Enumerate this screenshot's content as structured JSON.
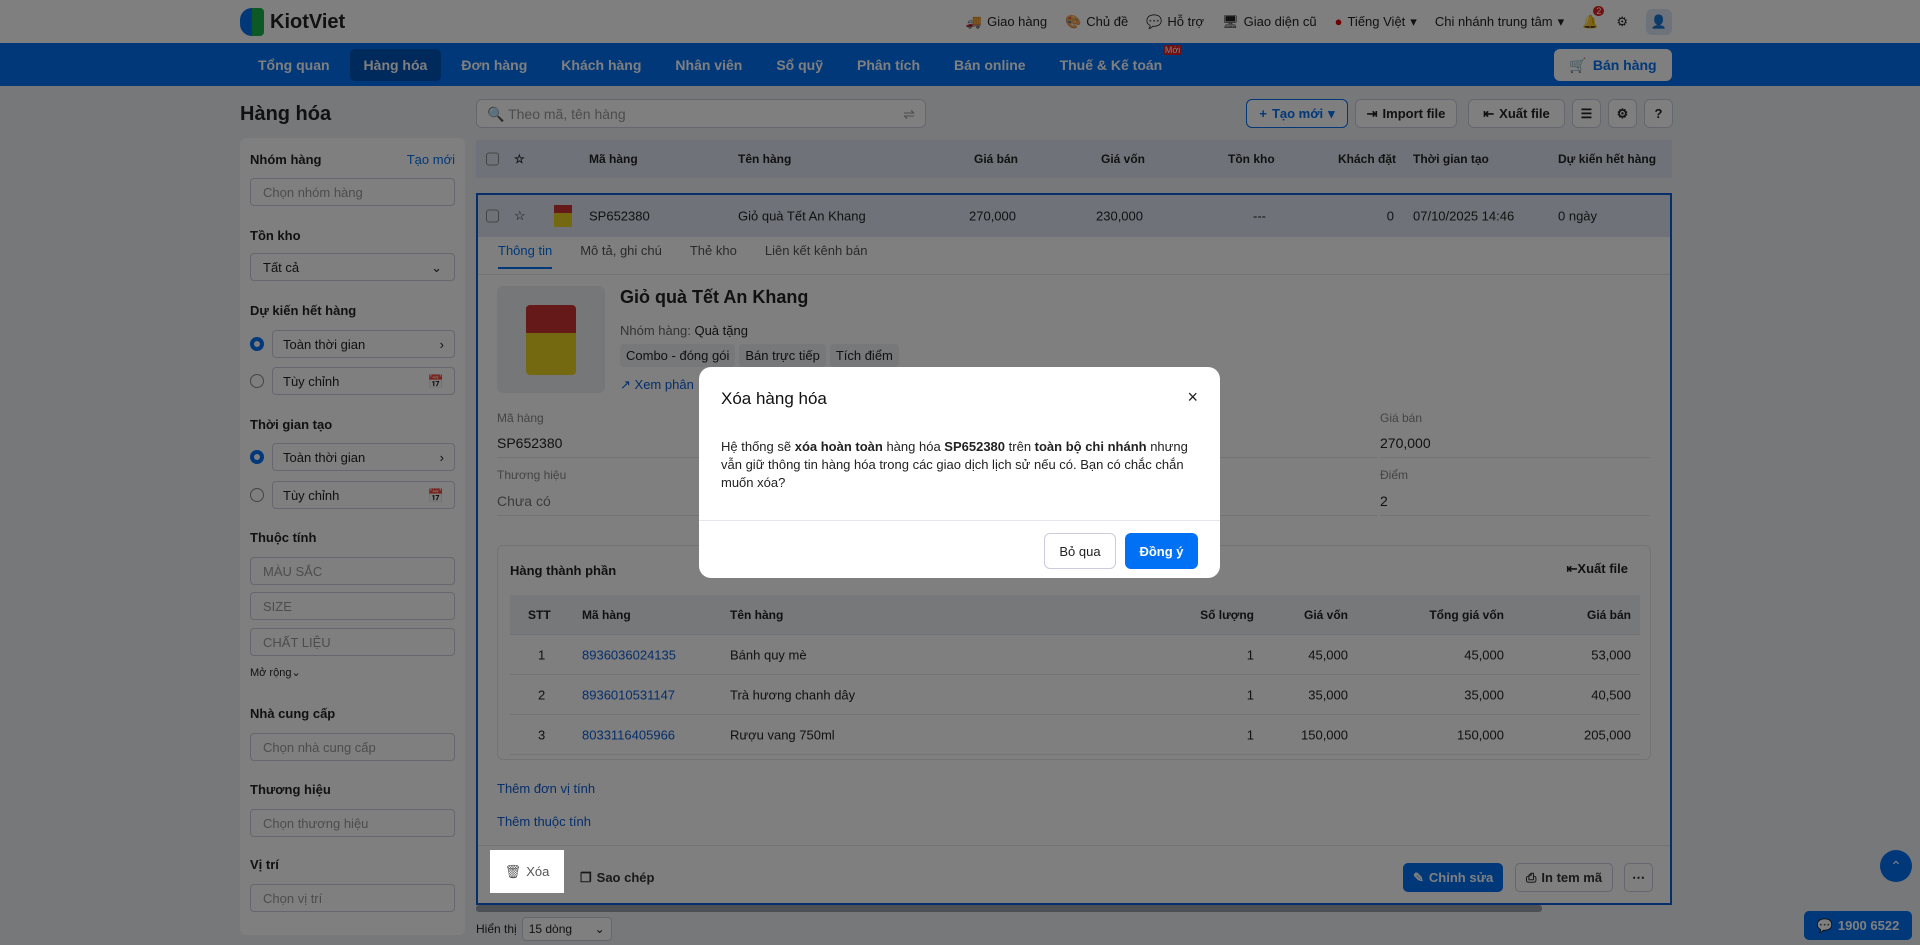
{
  "header": {
    "logo": "KiotViet",
    "links": [
      "Giao hàng",
      "Chủ đề",
      "Hỗ trợ",
      "Giao diện cũ"
    ],
    "language": "Tiếng Việt",
    "branch": "Chi nhánh trung tâm",
    "notifications": "2"
  },
  "nav": {
    "items": [
      "Tổng quan",
      "Hàng hóa",
      "Đơn hàng",
      "Khách hàng",
      "Nhân viên",
      "Sổ quỹ",
      "Phân tích",
      "Bán online",
      "Thuế & Kế toán"
    ],
    "new_badge": "Mới",
    "sell": "Bán hàng"
  },
  "page_title": "Hàng hóa",
  "sidebar": {
    "group_label": "Nhóm hàng",
    "group_create": "Tạo mới",
    "group_ph": "Chọn nhóm hàng",
    "stock_label": "Tồn kho",
    "stock_value": "Tất cả",
    "expected_label": "Dự kiến hết hàng",
    "all_time": "Toàn thời gian",
    "custom": "Tùy chỉnh",
    "created_label": "Thời gian tạo",
    "attr_label": "Thuộc tính",
    "attrs": [
      "MÀU SẮC",
      "SIZE",
      "CHẤT LIỆU"
    ],
    "expand": "Mở rộng",
    "supplier_label": "Nhà cung cấp",
    "supplier_ph": "Chọn nhà cung cấp",
    "brand_label": "Thương hiệu",
    "brand_ph": "Chọn thương hiệu",
    "location_label": "Vị trí",
    "location_ph": "Chọn vị trí"
  },
  "toolbar": {
    "search_ph": "Theo mã, tên hàng",
    "create": "Tạo mới",
    "import": "Import file",
    "export": "Xuất file"
  },
  "table": {
    "headers": [
      "Mã hàng",
      "Tên hàng",
      "Giá bán",
      "Giá vốn",
      "Tồn kho",
      "Khách đặt",
      "Thời gian tạo",
      "Dự kiến hết hàng"
    ],
    "row": [
      "SP652380",
      "Giỏ quà Tết An Khang",
      "270,000",
      "230,000",
      "---",
      "0",
      "07/10/2025 14:46",
      "0 ngày"
    ]
  },
  "detail": {
    "tabs": [
      "Thông tin",
      "Mô tả, ghi chú",
      "Thẻ kho",
      "Liên kết kênh bán"
    ],
    "name": "Giỏ quà Tết An Khang",
    "group_label": "Nhóm hàng:",
    "group_value": "Quà tặng",
    "chips": [
      "Combo - đóng gói",
      "Bán trực tiếp",
      "Tích điểm"
    ],
    "view_link": "Xem phân",
    "fields": {
      "code_label": "Mã hàng",
      "code": "SP652380",
      "brand_label": "Thương hiệu",
      "brand": "Chưa có",
      "price_label": "Giá bán",
      "price": "270,000",
      "points_label": "Điểm",
      "points": "2"
    },
    "components_title": "Hàng thành phần",
    "components_export": "Xuất file",
    "comp_headers": [
      "STT",
      "Mã hàng",
      "Tên hàng",
      "Số lượng",
      "Giá vốn",
      "Tổng giá vốn",
      "Giá bán"
    ],
    "comp_rows": [
      [
        "1",
        "8936036024135",
        "Bánh quy mè",
        "1",
        "45,000",
        "45,000",
        "53,000"
      ],
      [
        "2",
        "8936010531147",
        "Trà hương chanh dây",
        "1",
        "35,000",
        "35,000",
        "40,500"
      ],
      [
        "3",
        "8033116405966",
        "Rượu vang 750ml",
        "1",
        "150,000",
        "150,000",
        "205,000"
      ]
    ],
    "add_unit": "Thêm đơn vị tính",
    "add_attr": "Thêm thuộc tính",
    "delete": "Xóa",
    "copy": "Sao chép",
    "edit": "Chỉnh sửa",
    "print": "In tem mã"
  },
  "footer": {
    "show_label": "Hiển thị",
    "page_size": "15 dòng",
    "hotline": "1900 6522"
  },
  "dialog": {
    "title": "Xóa hàng hóa",
    "t1": "Hệ thống sẽ ",
    "b1": "xóa hoàn toàn",
    "t2": " hàng hóa ",
    "b2": "SP652380",
    "t3": " trên ",
    "b3": "toàn bộ chi nhánh",
    "t4": " nhưng vẫn giữ thông tin hàng hóa trong các giao dịch lịch sử nếu có. Bạn có chắc chắn muốn xóa?",
    "cancel": "Bỏ qua",
    "confirm": "Đồng ý"
  }
}
